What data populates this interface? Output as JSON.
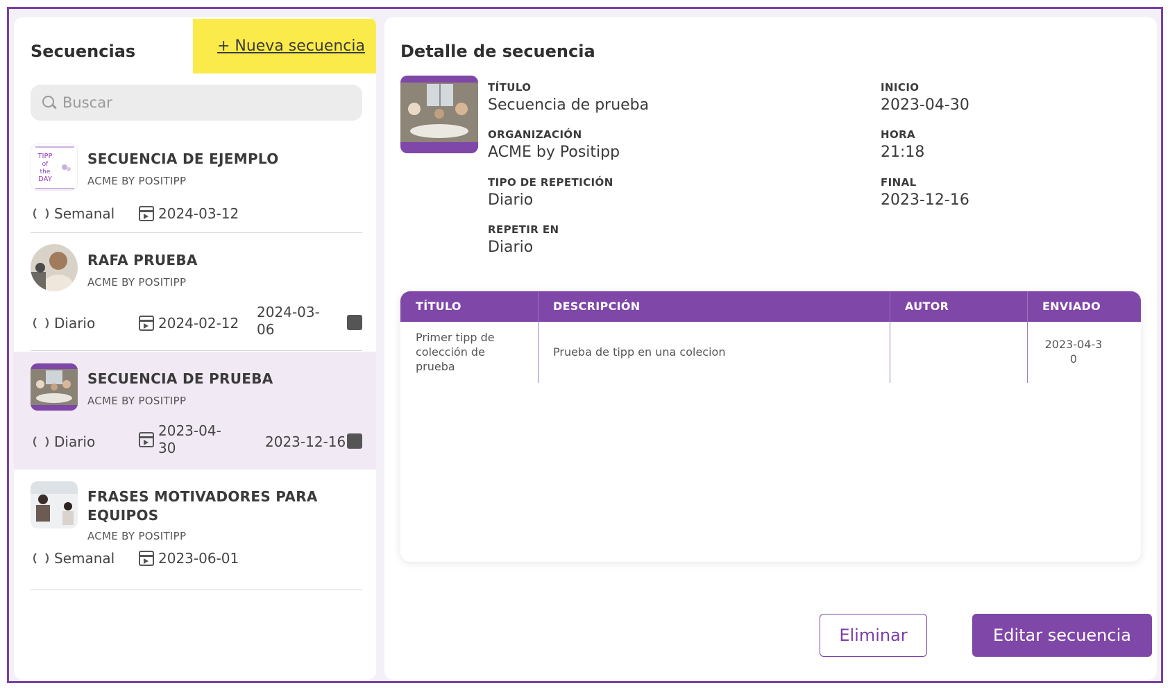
{
  "sidebar": {
    "title": "Secuencias",
    "new_label": "+ Nueva secuencia",
    "search_placeholder": "Buscar",
    "items": [
      {
        "name": "SECUENCIA DE EJEMPLO",
        "org": "ACME BY POSITIPP",
        "repeat": "Semanal",
        "start": "2024-03-12",
        "end": "",
        "thumb_text": "TIPP of the DAY"
      },
      {
        "name": "RAFA PRUEBA",
        "org": "ACME BY POSITIPP",
        "repeat": "Diario",
        "start": "2024-02-12",
        "end": "2024-03-06"
      },
      {
        "name": "SECUENCIA DE PRUEBA",
        "org": "ACME BY POSITIPP",
        "repeat": "Diario",
        "start": "2023-04-30",
        "end": "2023-12-16",
        "selected": true
      },
      {
        "name": "FRASES MOTIVADORES PARA EQUIPOS",
        "org": "ACME BY POSITIPP",
        "repeat": "Semanal",
        "start": "2023-06-01",
        "end": ""
      }
    ]
  },
  "detail": {
    "title": "Detalle de secuencia",
    "fields": {
      "titulo_label": "TÍTULO",
      "titulo_value": "Secuencia de prueba",
      "org_label": "ORGANIZACIÓN",
      "org_value": "ACME by Positipp",
      "tipo_label": "TIPO DE REPETICIÓN",
      "tipo_value": "Diario",
      "repetir_label": "REPETIR EN",
      "repetir_value": "Diario",
      "inicio_label": "INICIO",
      "inicio_value": "2023-04-30",
      "hora_label": "HORA",
      "hora_value": "21:18",
      "final_label": "FINAL",
      "final_value": "2023-12-16"
    },
    "table": {
      "headers": [
        "TÍTULO",
        "DESCRIPCIÓN",
        "AUTOR",
        "ENVIADO"
      ],
      "rows": [
        {
          "titulo": "Primer tipp de colección de prueba",
          "descripcion": "Prueba de tipp en una colecion",
          "autor": "",
          "enviado": "2023-04-30"
        }
      ]
    },
    "delete_label": "Eliminar",
    "edit_label": "Editar secuencia"
  },
  "colors": {
    "accent": "#7f47a8",
    "highlight": "#fbeb4a",
    "selected_bg": "#f1e9f3"
  }
}
